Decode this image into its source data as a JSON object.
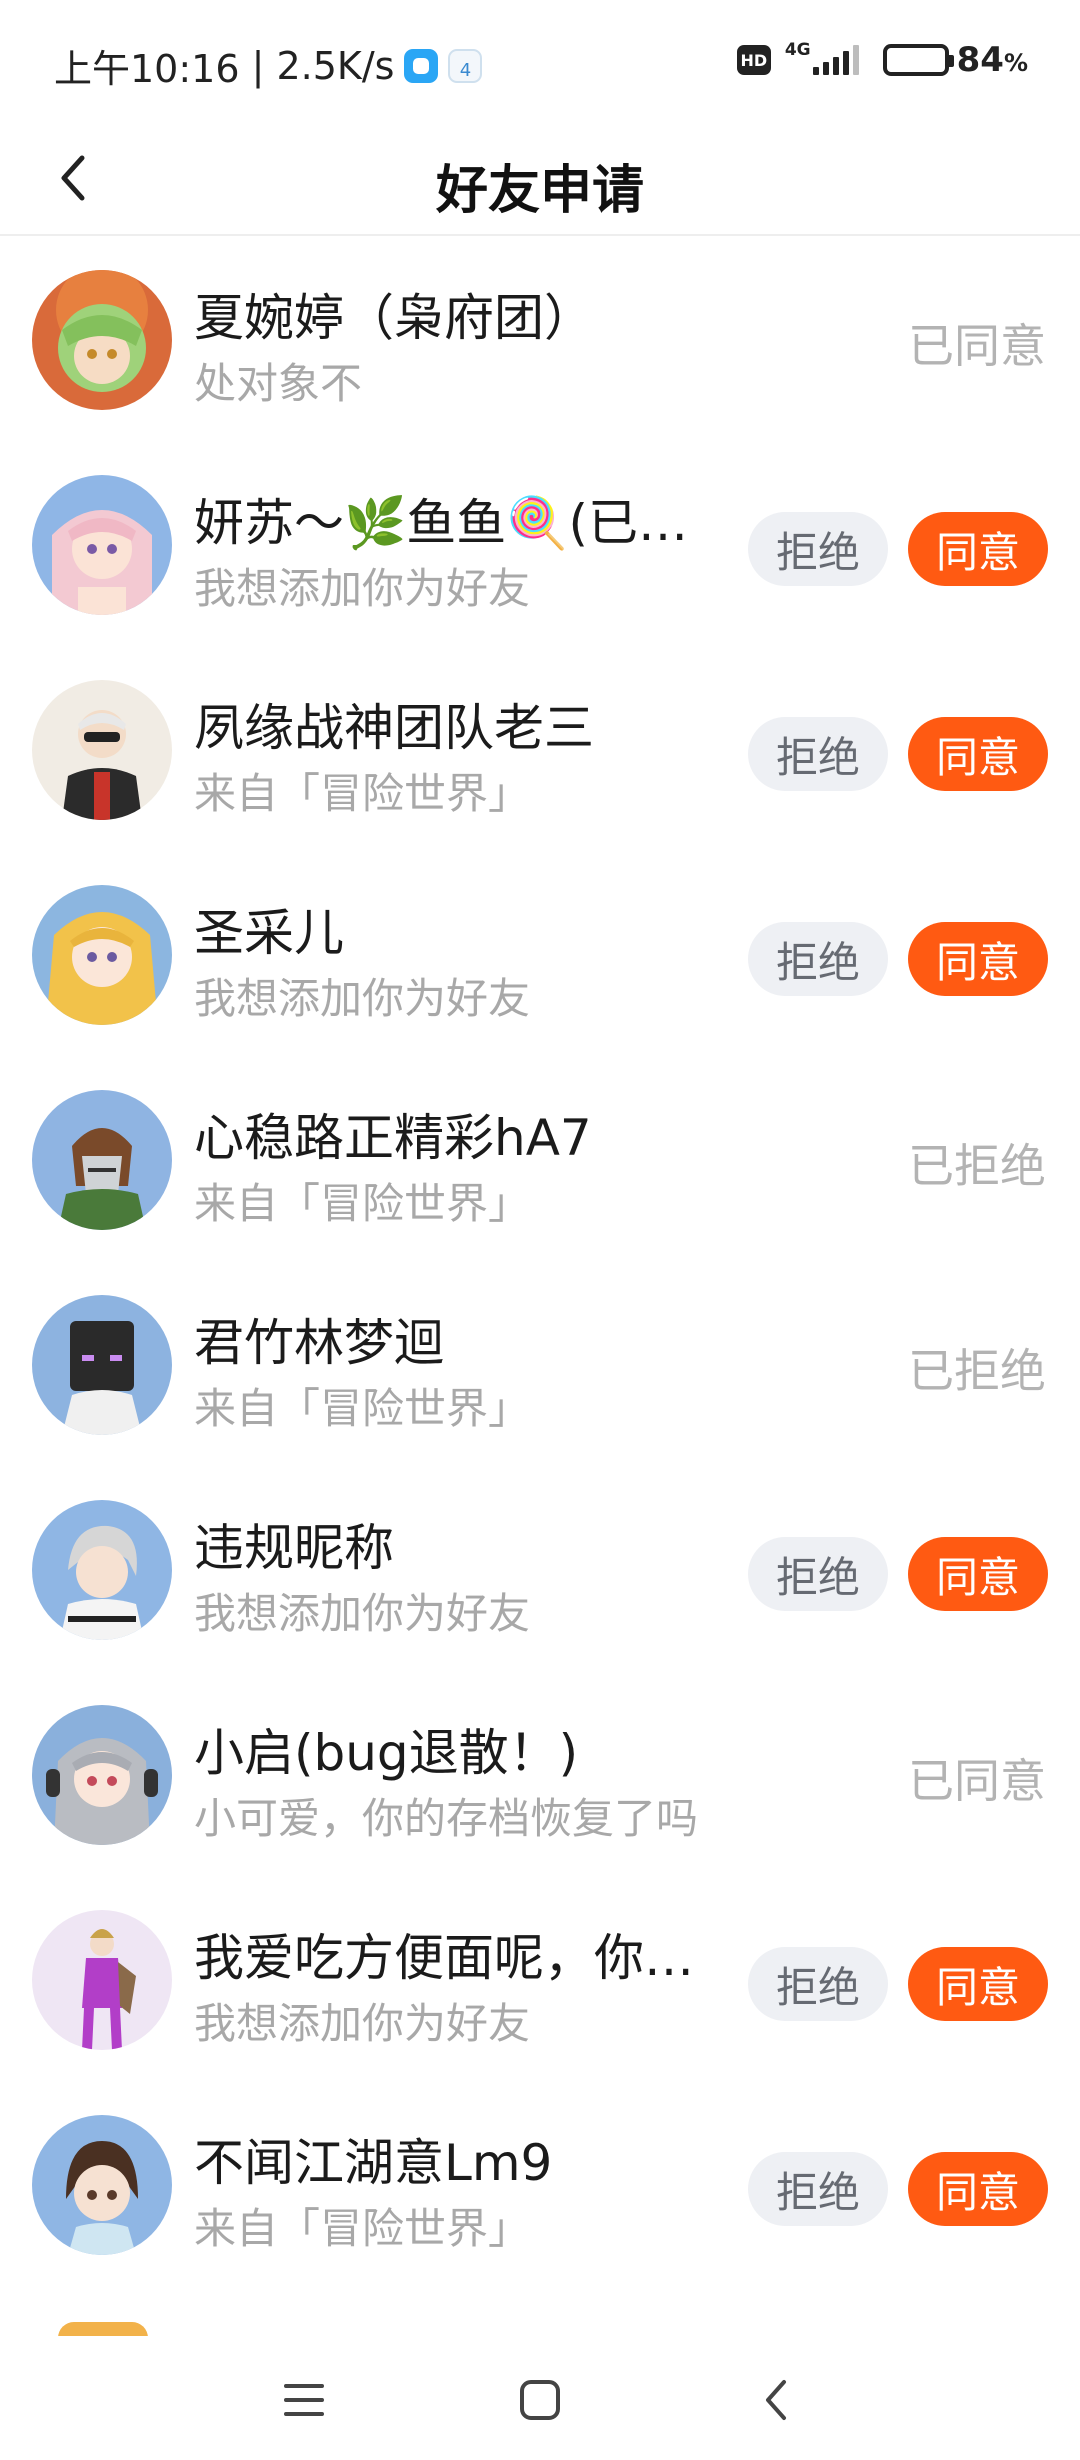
{
  "status_bar": {
    "time": "上午10:16",
    "speed": "2.5K/s",
    "hd": "HD",
    "network": "4G",
    "battery_percent": 84,
    "battery_text": "84",
    "battery_unit": "%"
  },
  "header": {
    "title": "好友申请"
  },
  "actions": {
    "reject_label": "拒绝",
    "accept_label": "同意"
  },
  "colors": {
    "accent": "#ff5a12",
    "reject_bg": "#eef0f4",
    "muted_text": "#b3b3b3"
  },
  "requests": [
    {
      "name": "夏婉婷（枭府团）",
      "message": "处对象不",
      "status": "已同意"
    },
    {
      "name": "妍苏～🌿鱼鱼🍭(已…",
      "message": "我想添加你为好友",
      "status": ""
    },
    {
      "name": "夙缘战神团队老三",
      "message": "来自「冒险世界」",
      "status": ""
    },
    {
      "name": "圣采儿",
      "message": "我想添加你为好友",
      "status": ""
    },
    {
      "name": "心稳路正精彩hA7",
      "message": "来自「冒险世界」",
      "status": "已拒绝"
    },
    {
      "name": "君竹林梦迴",
      "message": "来自「冒险世界」",
      "status": "已拒绝"
    },
    {
      "name": "违规昵称",
      "message": "我想添加你为好友",
      "status": ""
    },
    {
      "name": "小启(bug退散！)",
      "message": "小可爱，你的存档恢复了吗",
      "status": "已同意"
    },
    {
      "name": "我爱吃方便面呢，你…",
      "message": "我想添加你为好友",
      "status": ""
    },
    {
      "name": "不闻江湖意Lm9",
      "message": "来自「冒险世界」",
      "status": ""
    }
  ]
}
